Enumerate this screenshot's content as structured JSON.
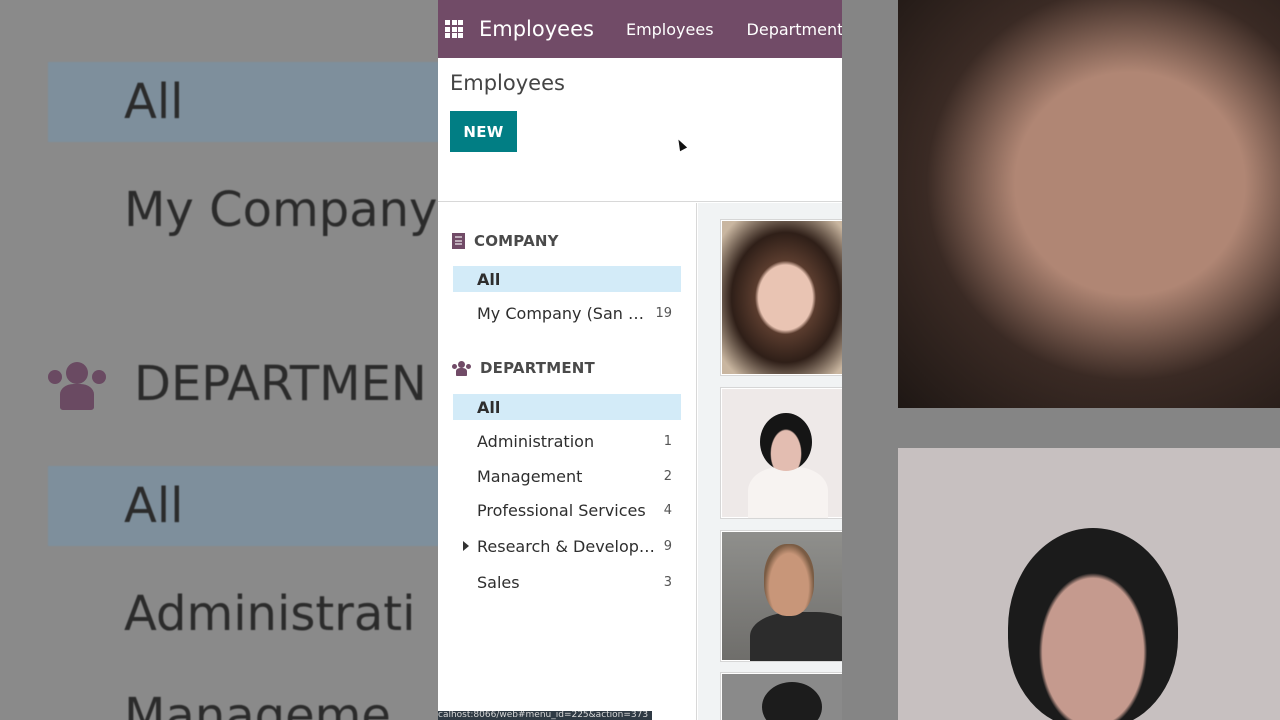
{
  "navbar": {
    "app_name": "Employees",
    "menu": [
      "Employees",
      "Department"
    ]
  },
  "control_panel": {
    "title": "Employees",
    "new_button": "NEW"
  },
  "search_panel": {
    "company": {
      "header": "COMPANY",
      "items": [
        {
          "label": "All",
          "count": "",
          "active": true
        },
        {
          "label": "My Company (San …",
          "count": "19",
          "active": false
        }
      ]
    },
    "department": {
      "header": "DEPARTMENT",
      "items": [
        {
          "label": "All",
          "count": "",
          "active": true
        },
        {
          "label": "Administration",
          "count": "1"
        },
        {
          "label": "Management",
          "count": "2"
        },
        {
          "label": "Professional Services",
          "count": "4"
        },
        {
          "label": "Research & Develop…",
          "count": "9",
          "expandable": true
        },
        {
          "label": "Sales",
          "count": "3"
        }
      ]
    }
  },
  "background_zoom": {
    "left_rows": [
      "All",
      "My Company",
      "DEPARTMEN",
      "All",
      "Administrati",
      "Manageme"
    ]
  },
  "status_url": "calhost:8066/web#menu_id=225&action=373",
  "colors": {
    "brand": "#714b67",
    "primary_button": "#017e84",
    "active_row": "#d3ebf8"
  },
  "icons": {
    "apps": "apps-grid-icon",
    "company": "building-icon",
    "department": "users-icon",
    "expand": "caret-right-icon"
  }
}
